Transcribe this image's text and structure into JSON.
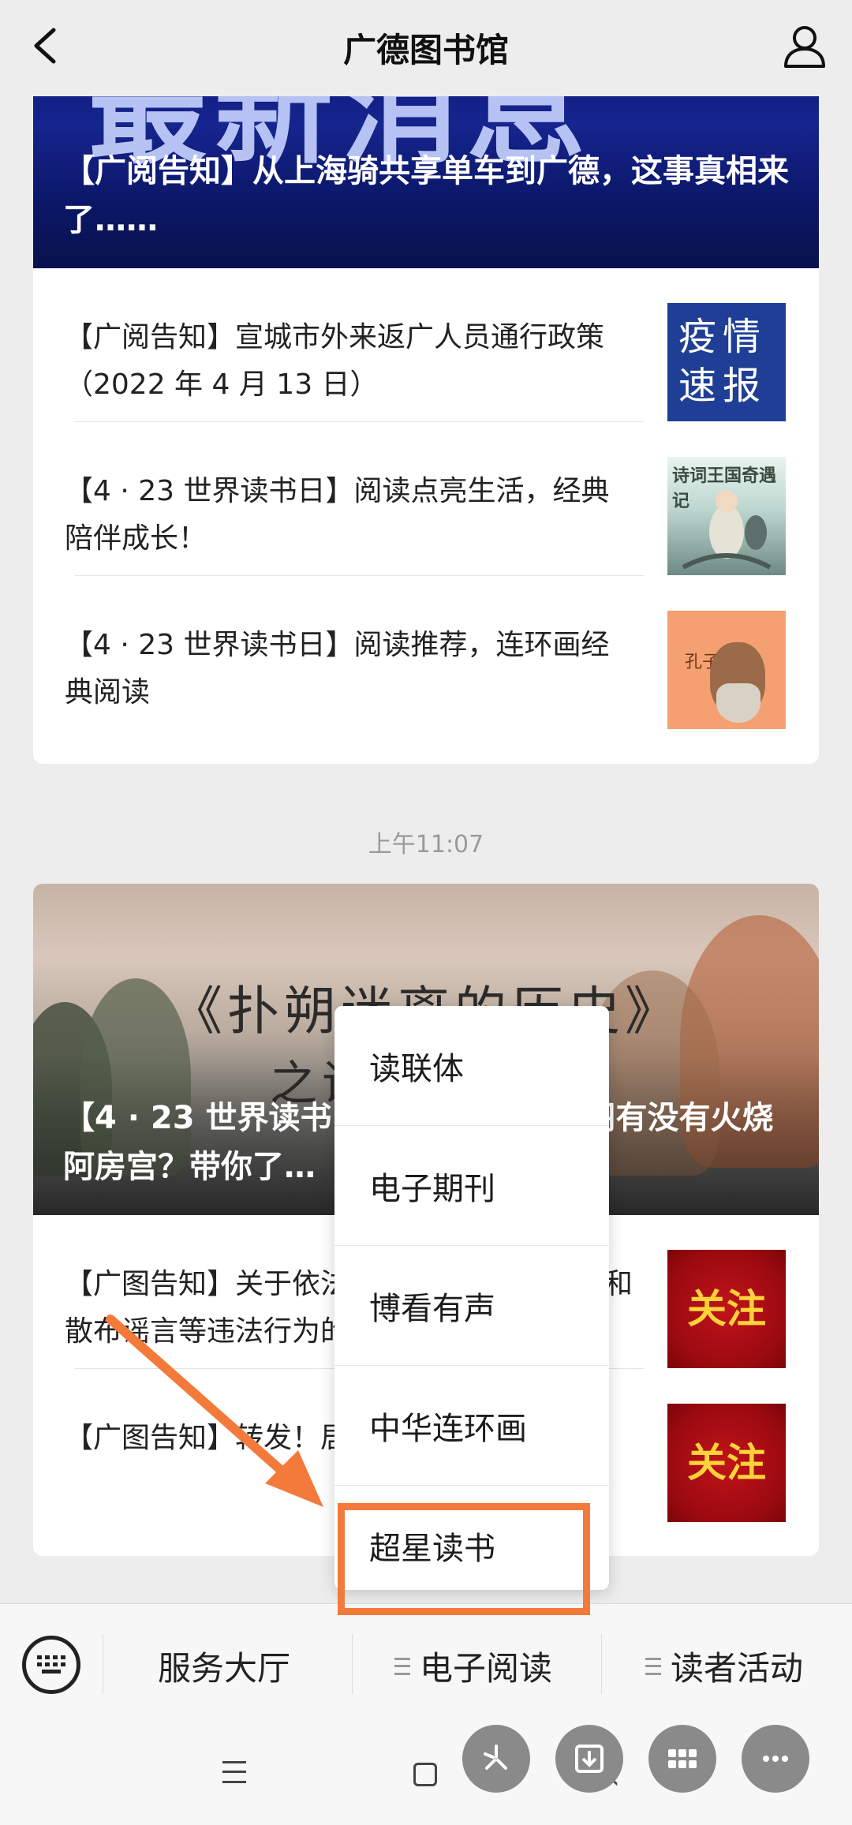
{
  "header": {
    "title": "广德图书馆"
  },
  "article_groups": [
    {
      "hero_title": "【广阅告知】从上海骑共享单车到广德，这事真相来了……",
      "hero_bg_text": "最新消息",
      "items": [
        {
          "title": "【广阅告知】宣城市外来返广人员通行政策（2022 年 4 月 13 日）",
          "thumb_text": "疫情速报"
        },
        {
          "title": "【4 · 23 世界读书日】阅读点亮生活，经典陪伴成长！",
          "thumb_text": "诗词王国奇遇记"
        },
        {
          "title": "【4 · 23 世界读书日】阅读推荐，连环画经典阅读",
          "thumb_text": "孔子"
        }
      ]
    },
    {
      "timestamp": "上午11:07",
      "hero_caption_line1": "《扑朔迷离的历史》",
      "hero_caption_line2": "之诸葛亮的命",
      "hero_title": "【4 · 23 世界读书日】点过秋香？项羽有没有火烧阿房宫？带你了…",
      "items": [
        {
          "title": "【广图告知】关于依法打击疫情防控中查验和散布谣言等违法行为的通告",
          "thumb_text": "关注"
        },
        {
          "title": "【广图告知】转发！居家防疫，请遵守要求",
          "thumb_text": "关注"
        }
      ]
    }
  ],
  "popup_menu": {
    "items": [
      "读联体",
      "电子期刊",
      "博看有声",
      "中华连环画",
      "超星读书"
    ],
    "highlighted": "超星读书",
    "highlight_color": "#f37a3b"
  },
  "bottom_menu": {
    "items": [
      "服务大厅",
      "电子阅读",
      "读者活动"
    ]
  },
  "colors": {
    "background": "#ededed",
    "accent": "#f37a3b"
  }
}
